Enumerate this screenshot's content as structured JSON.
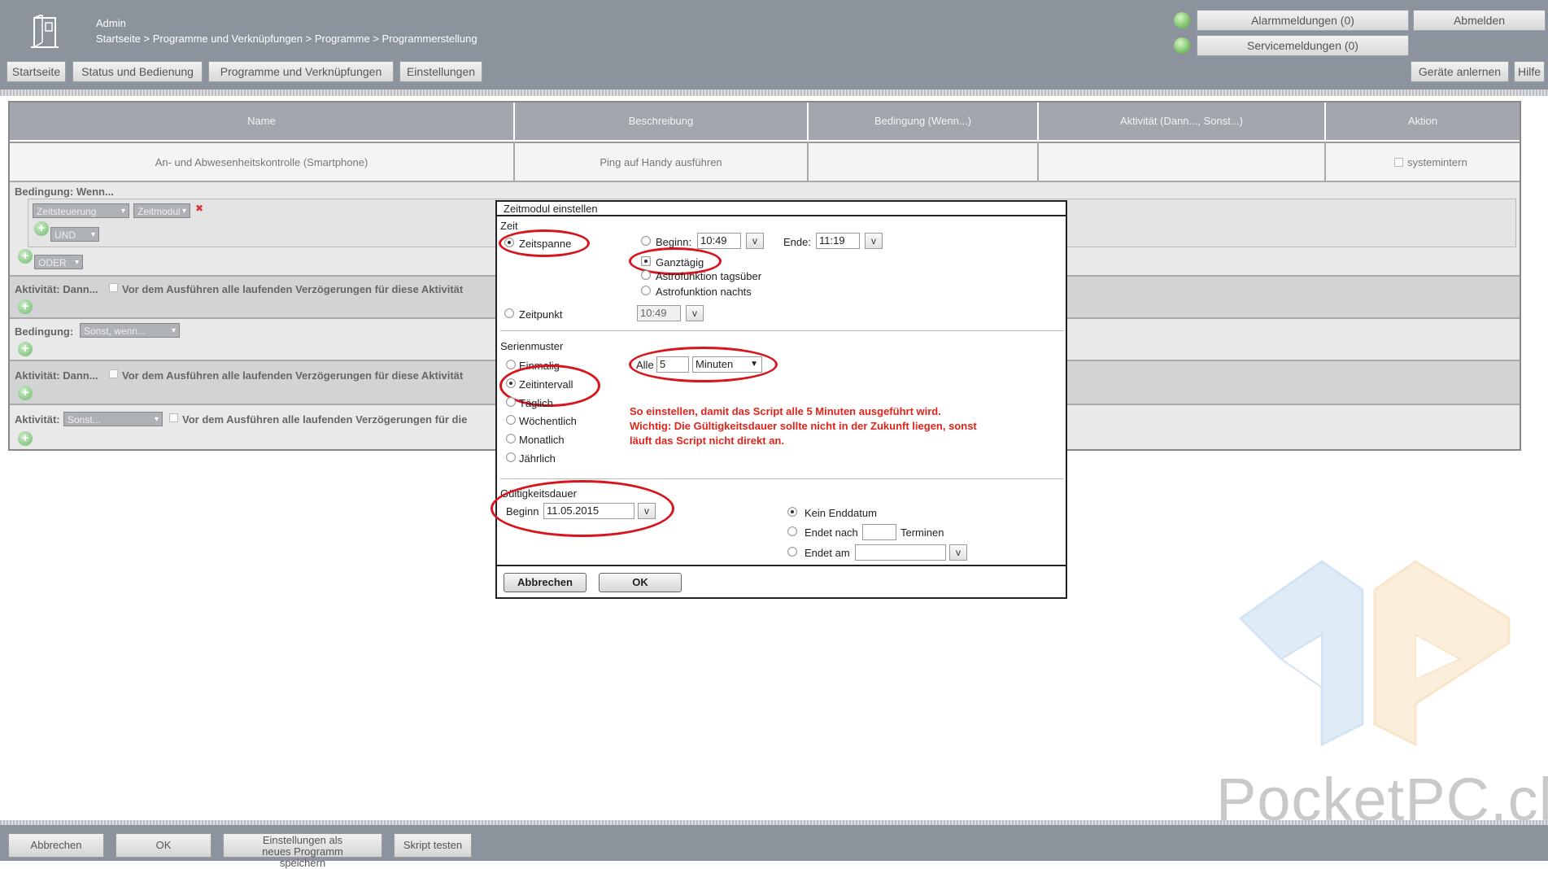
{
  "header": {
    "user": "Admin",
    "breadcrumb": "Startseite > Programme und Verknüpfungen > Programme > Programmerstellung",
    "alarm_label": "Alarmmeldungen (0)",
    "service_label": "Servicemeldungen (0)",
    "logout_label": "Abmelden",
    "teach_devices_label": "Geräte anlernen",
    "help_label": "Hilfe",
    "nav": [
      "Startseite",
      "Status und Bedienung",
      "Programme und Verknüpfungen",
      "Einstellungen"
    ]
  },
  "table": {
    "columns": [
      "Name",
      "Beschreibung",
      "Bedingung (Wenn...)",
      "Aktivität (Dann..., Sonst...)",
      "Aktion"
    ],
    "row": {
      "name": "An- und Abwesenheitskontrolle (Smartphone)",
      "description": "Ping auf Handy ausführen",
      "condition": "",
      "activity": "",
      "action": "systemintern"
    }
  },
  "program": {
    "condition_label": "Bedingung: Wenn...",
    "trigger_select": "Zeitsteuerung",
    "time_module_button": "Zeitmodul",
    "and_select": "UND",
    "or_select": "ODER",
    "activity_then_label": "Aktivität: Dann...",
    "delay_text": "Vor dem Ausführen alle laufenden Verzögerungen für diese Aktivität",
    "condition_else_label": "Bedingung:",
    "else_if_select": "Sonst, wenn...",
    "activity_then2_label": "Aktivität: Dann...",
    "activity_else_label": "Aktivität:",
    "else_select": "Sonst...",
    "delay_text_short": "Vor dem Ausführen alle laufenden Verzögerungen für die"
  },
  "dialog": {
    "title": "Zeitmodul einstellen",
    "zeit_heading": "Zeit",
    "zeitspanne": "Zeitspanne",
    "beginn_label": "Beginn:",
    "beginn_value": "10:49",
    "ende_label": "Ende:",
    "ende_value": "11:19",
    "ganztaegig": "Ganztägig",
    "astro_day": "Astrofunktion tagsüber",
    "astro_night": "Astrofunktion nachts",
    "zeitpunkt": "Zeitpunkt",
    "zeitpunkt_value": "10:49",
    "v": "v",
    "serienmuster_heading": "Serienmuster",
    "einmalig": "Einmalig",
    "zeitintervall": "Zeitintervall",
    "taeglich": "Täglich",
    "woechentlich": "Wöchentlich",
    "monatlich": "Monatlich",
    "jaehrlich": "Jährlich",
    "alle_label": "Alle",
    "alle_value": "5",
    "unit_select": "Minuten",
    "note_line1": "So einstellen, damit das Script alle 5 Minuten ausgeführt wird.",
    "note_line2": "Wichtig: Die Gültigkeitsdauer sollte nicht in der Zukunft liegen, sonst",
    "note_line3": "läuft das Script nicht direkt an.",
    "validity_heading": "Gültigkeitsdauer",
    "validity_begin_label": "Beginn",
    "validity_begin_value": "11.05.2015",
    "kein_enddatum": "Kein Enddatum",
    "endet_nach": "Endet nach",
    "terminen": "Terminen",
    "endet_am": "Endet am",
    "cancel": "Abbrechen",
    "ok": "OK"
  },
  "footer": {
    "cancel": "Abbrechen",
    "ok": "OK",
    "save_as_new": "Einstellungen als neues Programm speichern",
    "test_script": "Skript testen"
  },
  "watermark": "PocketPC.ch",
  "colors": {
    "header_bg": "#8d939d",
    "annotation_red": "#d8141c",
    "led_green": "#7dc46a"
  }
}
